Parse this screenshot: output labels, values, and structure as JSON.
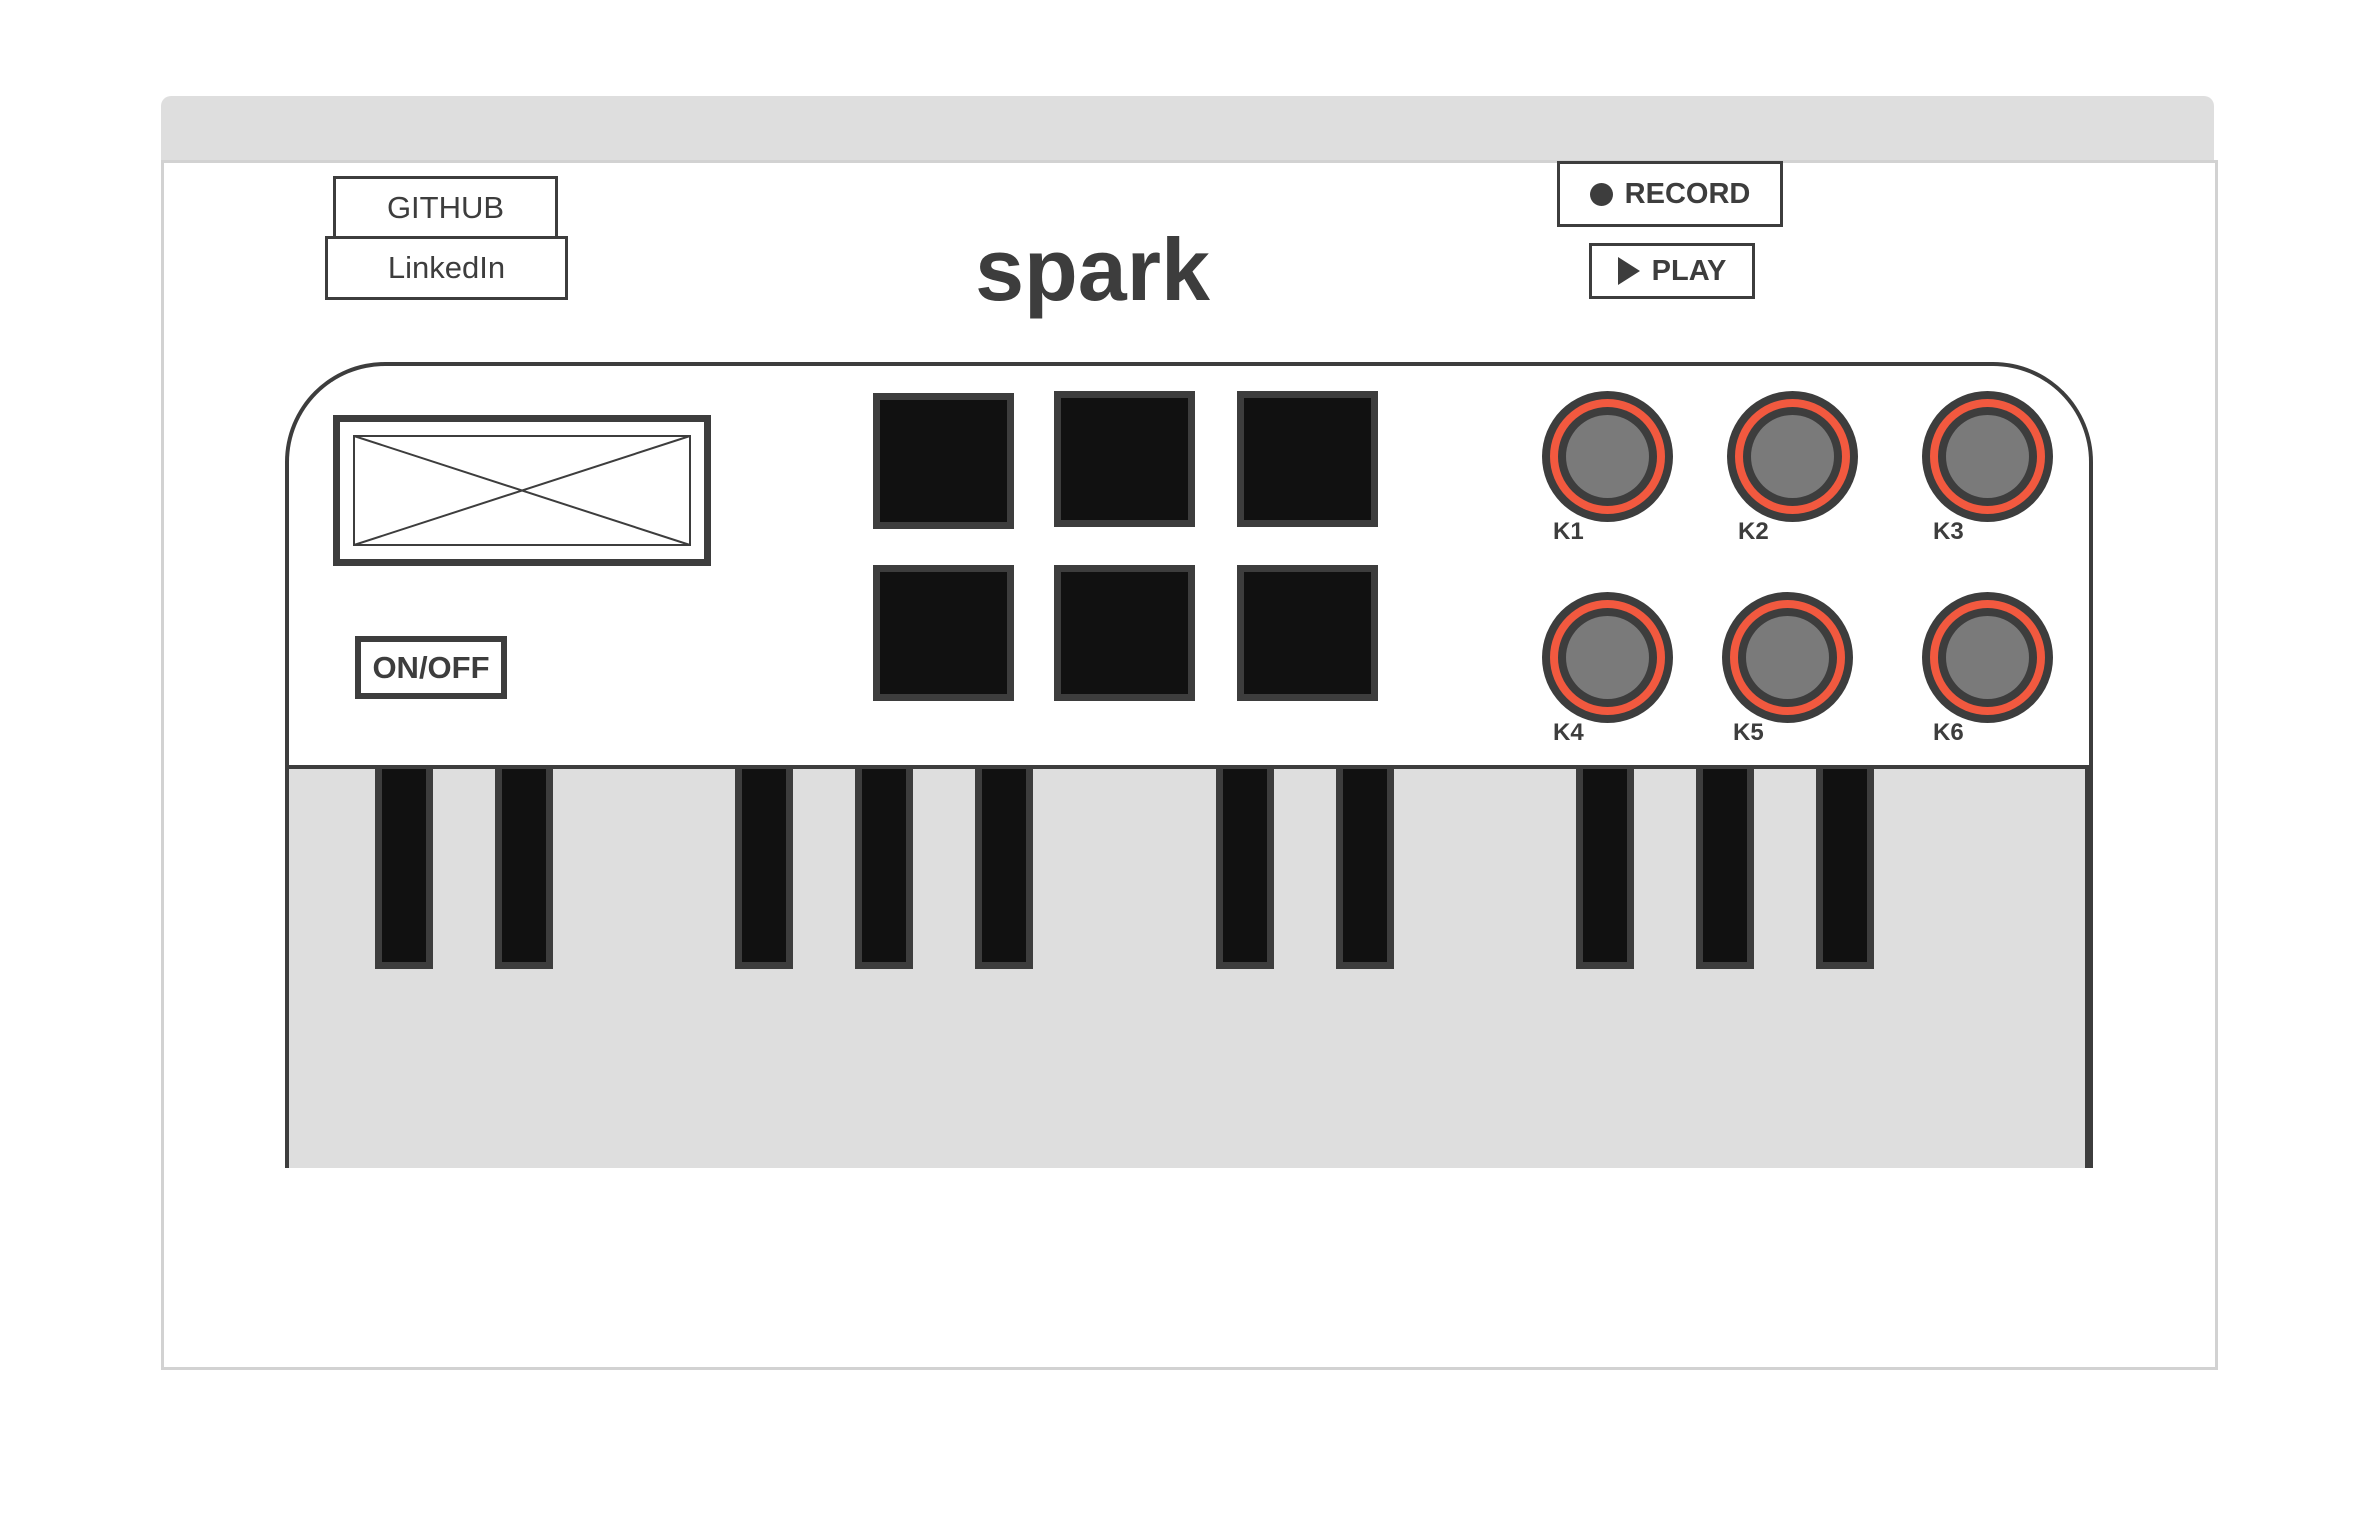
{
  "header": {
    "github_label": "GITHUB",
    "linkedin_label": "LinkedIn",
    "title": "spark",
    "record_label": "RECORD",
    "play_label": "PLAY"
  },
  "synth": {
    "power_label": "ON/OFF",
    "pads": [
      "pad-1",
      "pad-2",
      "pad-3",
      "pad-4",
      "pad-5",
      "pad-6"
    ],
    "knobs": [
      "K1",
      "K2",
      "K3",
      "K4",
      "K5",
      "K6"
    ],
    "white_key_count": 15,
    "black_key_count": 10
  },
  "colors": {
    "knob_ring": "#f2593f",
    "dark": "#3d3d3d",
    "key_black": "#111111",
    "key_white": "#dedede"
  },
  "icons": {
    "record": "record-dot-icon",
    "play": "play-triangle-icon",
    "screen": "image-placeholder-icon"
  }
}
